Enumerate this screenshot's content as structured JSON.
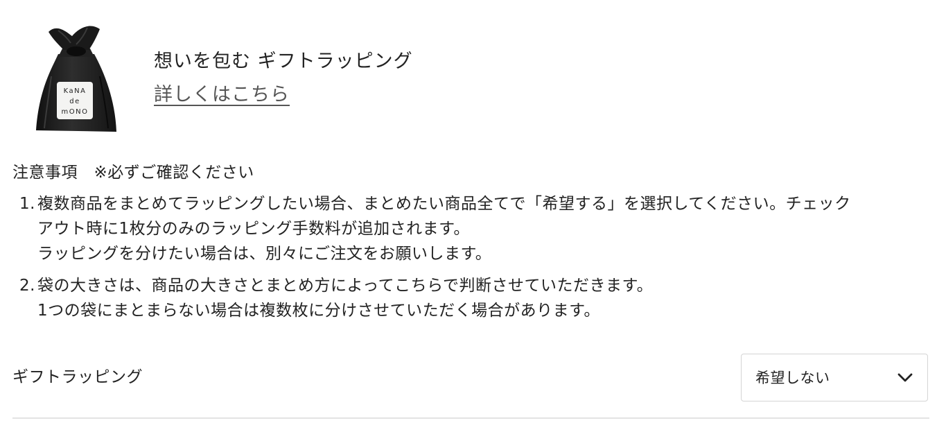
{
  "promo": {
    "title": "想いを包む ギフトラッピング",
    "link_label": "詳しくはこちら",
    "bag_tag": {
      "line1": "KaNA",
      "line2": "de",
      "line3": "mONO"
    }
  },
  "notice": {
    "heading": "注意事項　※必ずご確認ください",
    "items": [
      {
        "number": "1.",
        "lines": [
          "複数商品をまとめてラッピングしたい場合、まとめたい商品全てで「希望する」を選択してください。チェック",
          "アウト時に1枚分のみのラッピング手数料が追加されます。",
          "ラッピングを分けたい場合は、別々にご注文をお願いします。"
        ]
      },
      {
        "number": "2.",
        "lines": [
          "袋の大きさは、商品の大きさとまとめ方によってこちらで判断させていただきます。",
          "1つの袋にまとまらない場合は複数枚に分けさせていただく場合があります。"
        ]
      }
    ]
  },
  "gift_option": {
    "label": "ギフトラッピング",
    "selected": "希望しない",
    "icon": "chevron-down-icon"
  },
  "colors": {
    "text": "#222222",
    "link": "#555555",
    "bag": "#1c1c1c",
    "border": "#d4d4d4",
    "divider": "#e3e3e3"
  }
}
